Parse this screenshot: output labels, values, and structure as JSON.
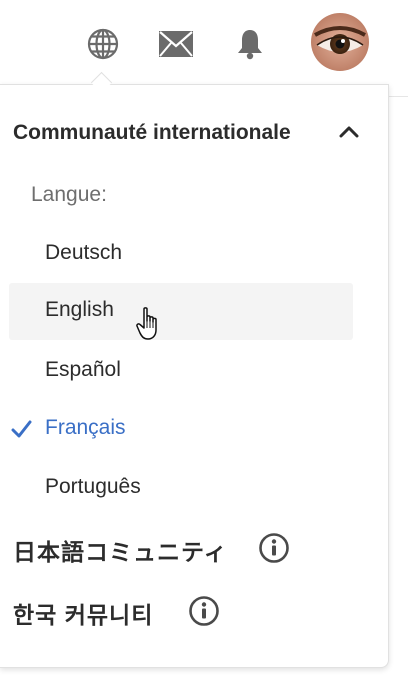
{
  "header": {
    "icons": [
      "globe-icon",
      "mail-icon",
      "bell-icon"
    ],
    "avatar": "user-avatar"
  },
  "dropdown": {
    "section_title": "Communauté internationale",
    "language_label": "Langue:",
    "languages": [
      {
        "label": "Deutsch",
        "selected": false,
        "hovered": false
      },
      {
        "label": "English",
        "selected": false,
        "hovered": true
      },
      {
        "label": "Español",
        "selected": false,
        "hovered": false
      },
      {
        "label": "Français",
        "selected": true,
        "hovered": false
      },
      {
        "label": "Português",
        "selected": false,
        "hovered": false
      }
    ],
    "communities": [
      {
        "label": "日本語コミュニティ"
      },
      {
        "label": "한국 커뮤니티"
      }
    ]
  },
  "colors": {
    "selected": "#3a6fc6",
    "text": "#2c2c2c",
    "muted": "#6e6e6e",
    "hover_bg": "#f4f4f4",
    "icon": "#6b6b6b"
  }
}
